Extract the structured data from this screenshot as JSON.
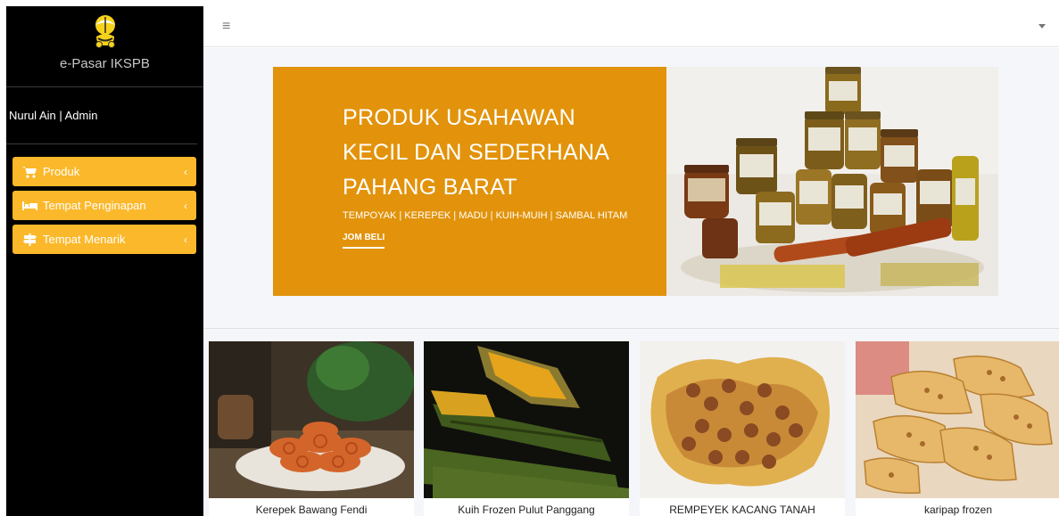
{
  "app": {
    "brand": "e-Pasar IKSPB"
  },
  "user": {
    "label": "Nurul Ain | Admin"
  },
  "sidebar": {
    "items": [
      {
        "label": "Produk",
        "icon": "cart-icon"
      },
      {
        "label": "Tempat Penginapan",
        "icon": "bed-icon"
      },
      {
        "label": "Tempat Menarik",
        "icon": "signpost-icon"
      }
    ]
  },
  "topbar": {
    "menu_icon": "≡"
  },
  "banner": {
    "title_lines": [
      "PRODUK USAHAWAN",
      "KECIL DAN SEDERHANA",
      "PAHANG BARAT"
    ],
    "subtitle": "TEMPOYAK | KEREPEK | MADU | KUIH-MUIH | SAMBAL HITAM",
    "cta": "JOM BELI"
  },
  "products": [
    {
      "name": "Kerepek Bawang Fendi"
    },
    {
      "name": "Kuih Frozen Pulut Panggang"
    },
    {
      "name": "REMPEYEK KACANG TANAH"
    },
    {
      "name": "karipap frozen"
    }
  ],
  "colors": {
    "accent": "#fbb82a",
    "banner": "#e2930b",
    "sidebar": "#000000"
  }
}
